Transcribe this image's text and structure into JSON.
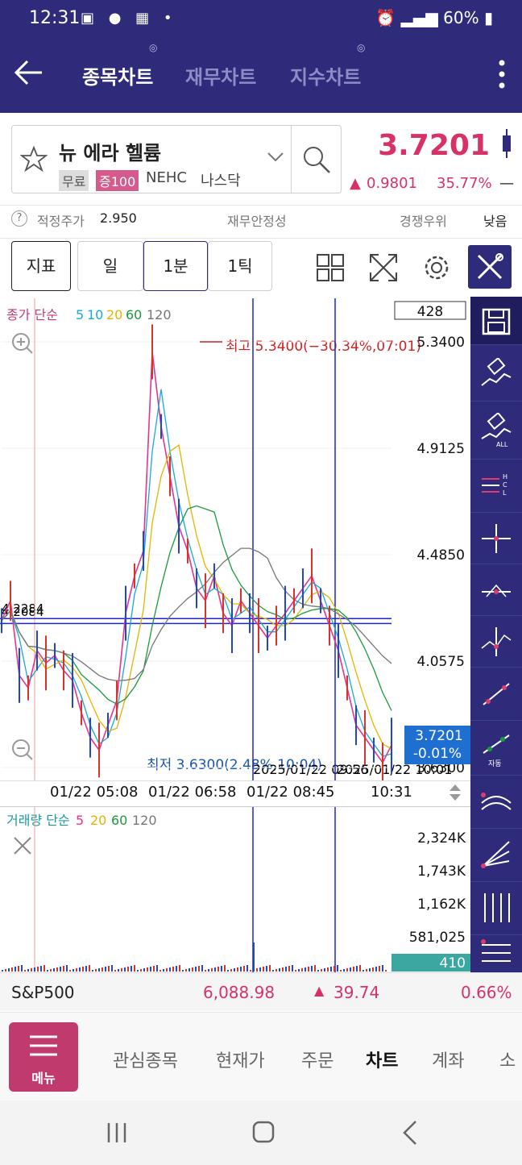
{
  "status_bar": {
    "time": "12:31",
    "battery": "60%"
  },
  "header": {
    "tabs": [
      {
        "label": "종목차트",
        "active": true
      },
      {
        "label": "재무차트",
        "active": false
      },
      {
        "label": "지수차트",
        "active": false
      }
    ]
  },
  "stock": {
    "name": "뉴 에라 헬륨",
    "badges": [
      "무료",
      "증100"
    ],
    "ticker": "NEHC",
    "market": "나스닥",
    "price": "3.7201",
    "change_abs": "0.9801",
    "change_pct": "35.77%",
    "change_suffix": "—"
  },
  "info_row": {
    "help": "?",
    "fair_price_label": "적정주가",
    "fair_price": "2.950",
    "financial_label": "재무안정성",
    "competition_label": "경쟁우위",
    "competition_value": "낮음"
  },
  "toolbar": {
    "indicator_label": "지표",
    "period_day": "일",
    "period_minute": "1분",
    "period_tick": "1틱"
  },
  "chart": {
    "legend_prefix": "종가 단순",
    "ma_periods": [
      "5",
      "10",
      "20",
      "60",
      "120"
    ],
    "ma_colors": [
      "#e5338f",
      "#19a8d6",
      "#e5b300",
      "#1b9a3a",
      "#777777"
    ],
    "top_box": "428",
    "high_label": "최고 5.3400(−30.34%,07:01)",
    "low_label": "최저 3.6300(2.48%,10:04)",
    "level_label": "4.2084",
    "level_label2": "4.2284",
    "price_ticks": [
      "5.3400",
      "4.9125",
      "4.4850",
      "4.0575",
      "3.6300"
    ],
    "current_price_label": "3.7201",
    "current_pct_label": "-0.01%",
    "crosshair_time_label": "2025/01/22 09:56",
    "crosshair_time_label2": "2025/01/22 10:01"
  },
  "chart_data": {
    "type": "line",
    "title": "",
    "ylim": [
      3.63,
      5.34
    ],
    "x_ticks": [
      "01/22 05:08",
      "01/22 06:58",
      "01/22 08:45",
      "10:31"
    ],
    "series": [
      {
        "values": [
          4.22,
          4.3,
          4.0,
          3.95,
          4.1,
          4.05,
          4.08,
          4.02,
          3.98,
          3.85,
          3.75,
          3.7,
          3.8,
          3.9,
          4.25,
          4.4,
          4.5,
          5.3,
          5.0,
          4.8,
          4.6,
          4.5,
          4.35,
          4.3,
          4.4,
          4.25,
          4.2,
          4.3,
          4.25,
          4.2,
          4.15,
          4.2,
          4.25,
          4.3,
          4.35,
          4.4,
          4.3,
          4.2,
          4.1,
          3.95,
          3.8,
          3.75,
          3.7,
          3.65,
          3.72
        ]
      }
    ]
  },
  "volume": {
    "legend_prefix": "거래량 단순",
    "ma_periods": [
      "5",
      "20",
      "60",
      "120"
    ],
    "ma_colors": [
      "#e5338f",
      "#e5b300",
      "#1b9a3a",
      "#777777"
    ],
    "ticks": [
      "2,324K",
      "1,743K",
      "1,162K",
      "581,025"
    ],
    "current_volume": "410"
  },
  "index_bar": {
    "name": "S&P500",
    "value": "6,088.98",
    "change": "39.74",
    "change_pct": "0.66%"
  },
  "bottom_nav": {
    "menu_label": "메뉴",
    "items": [
      "관심종목",
      "현재가",
      "주문",
      "차트",
      "계좌",
      "소"
    ]
  }
}
